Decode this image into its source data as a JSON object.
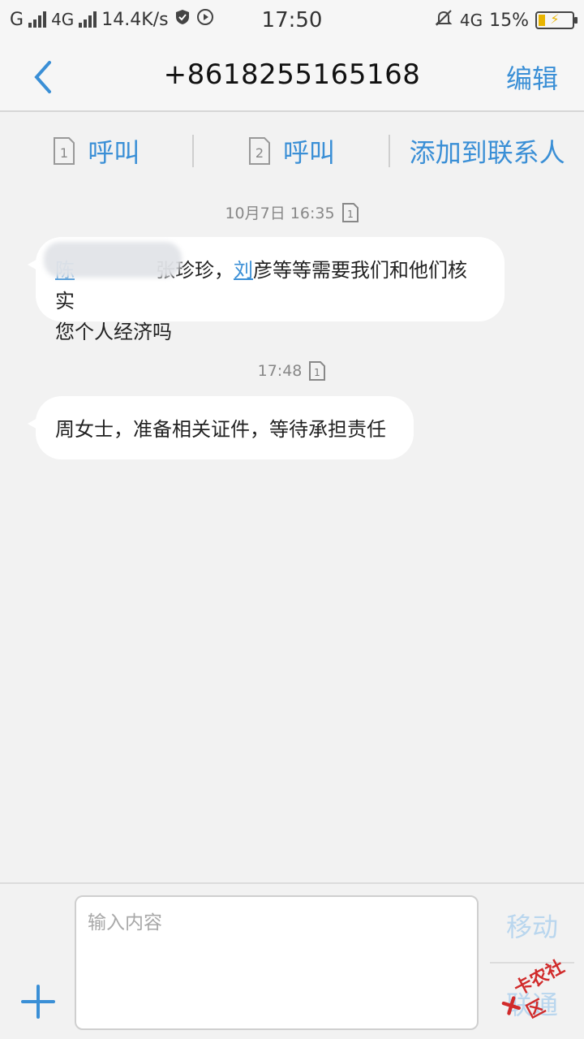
{
  "status_bar": {
    "carrier1": "G",
    "network": "4G",
    "speed": "14.4K/s",
    "time": "17:50",
    "network2": "4G",
    "battery": "15%"
  },
  "header": {
    "title": "+8618255165168",
    "edit": "编辑"
  },
  "actions": {
    "sim1_label": "1",
    "sim1_call": "呼叫",
    "sim2_label": "2",
    "sim2_call": "呼叫",
    "add_contact": "添加到联系人"
  },
  "messages": [
    {
      "timestamp": "10月7日 16:35",
      "sim": "1",
      "text_prefix": "陈",
      "text_part1": "张珍珍，",
      "link_text": "刘",
      "text_part2": "彦等等需要我们和他们核实",
      "text_line2": "您个人经济吗"
    },
    {
      "timestamp": "17:48",
      "sim": "1",
      "text": "周女士，准备相关证件，等待承担责任"
    }
  ],
  "composer": {
    "placeholder": "输入内容",
    "move": "移动",
    "send": "联通"
  },
  "watermark": {
    "text": "卡农社区"
  },
  "colors": {
    "accent": "#3a8fd6",
    "disabled": "#b9d6ee",
    "bubble": "#ffffff",
    "background": "#f2f2f2"
  }
}
